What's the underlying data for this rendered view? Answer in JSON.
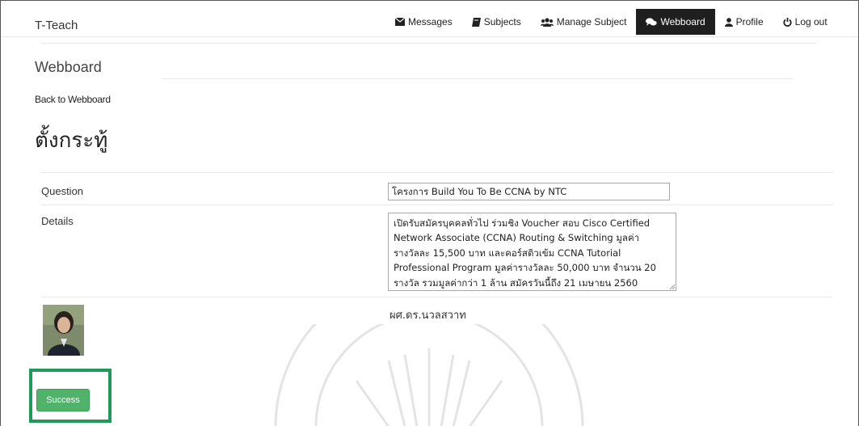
{
  "app": {
    "brand": "T-Teach"
  },
  "nav": {
    "items": [
      {
        "label": "Messages",
        "icon": "envelope-icon",
        "active": false
      },
      {
        "label": "Subjects",
        "icon": "book-icon",
        "active": false
      },
      {
        "label": "Manage Subject",
        "icon": "users-icon",
        "active": false
      },
      {
        "label": "Webboard",
        "icon": "comments-icon",
        "active": true
      },
      {
        "label": "Profile",
        "icon": "user-icon",
        "active": false
      },
      {
        "label": "Log out",
        "icon": "power-icon",
        "active": false
      }
    ]
  },
  "page": {
    "heading": "Webboard",
    "back_link": "Back to Webboard",
    "title": "ตั้งกระทู้"
  },
  "form": {
    "question_label": "Question",
    "details_label": "Details",
    "question_value": "โครงการ Build You To Be CCNA by NTC",
    "details_lines": [
      "เปิดรับสมัครบุคคลทั่วไป ร่วมชิง Voucher สอบ Cisco Certified",
      "Network Associate (CCNA) Routing & Switching มูลค่า",
      "รางวัลละ 15,500 บาท และคอร์สติวเข้ม CCNA Tutorial",
      "Professional Program มูลค่ารางวัลละ 50,000 บาท จำนวน 20",
      "รางวัล รวมมูลค่ากว่า 1 ล้าน สมัครวันนี้ถึง 21 เมษายน 2560"
    ],
    "author": "ผศ.ดร.นวลสวาท",
    "submit_label": "Success"
  },
  "colors": {
    "active_nav_bg": "#1f1f1f",
    "success_button": "#4fb36a",
    "highlight_border": "#1f9a5a"
  }
}
